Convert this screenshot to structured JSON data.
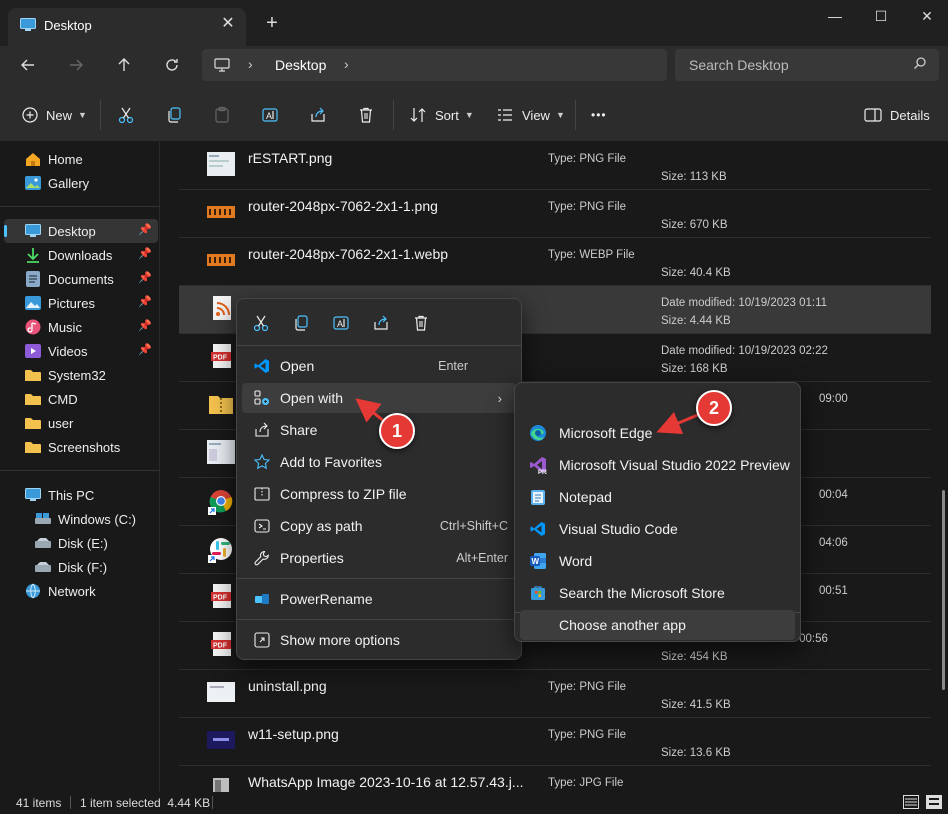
{
  "window": {
    "tab_title": "Desktop",
    "new_tab": "+",
    "minimize": "—",
    "maximize": "☐",
    "close": "✕",
    "tab_close": "✕"
  },
  "address": {
    "crumb": "Desktop",
    "search_placeholder": "Search Desktop"
  },
  "toolbar": {
    "new_label": "New",
    "sort_label": "Sort",
    "view_label": "View",
    "more_label": "•••",
    "details_label": "Details"
  },
  "sidebar": {
    "items": [
      {
        "label": "Home",
        "icon": "home-icon"
      },
      {
        "label": "Gallery",
        "icon": "gallery-icon"
      },
      {
        "label": "Desktop",
        "icon": "desktop-icon",
        "pinned": true,
        "selected": true
      },
      {
        "label": "Downloads",
        "icon": "download-icon",
        "pinned": true
      },
      {
        "label": "Documents",
        "icon": "documents-icon",
        "pinned": true
      },
      {
        "label": "Pictures",
        "icon": "pictures-icon",
        "pinned": true
      },
      {
        "label": "Music",
        "icon": "music-icon",
        "pinned": true
      },
      {
        "label": "Videos",
        "icon": "videos-icon",
        "pinned": true
      },
      {
        "label": "System32",
        "icon": "folder-icon"
      },
      {
        "label": "CMD",
        "icon": "folder-icon"
      },
      {
        "label": "user",
        "icon": "folder-icon"
      },
      {
        "label": "Screenshots",
        "icon": "folder-icon"
      },
      {
        "label": "This PC",
        "icon": "pc-icon"
      },
      {
        "label": "Windows (C:)",
        "icon": "drive-icon"
      },
      {
        "label": "Disk (E:)",
        "icon": "drive-icon"
      },
      {
        "label": "Disk (F:)",
        "icon": "drive-icon"
      },
      {
        "label": "Network",
        "icon": "network-icon"
      }
    ]
  },
  "files": [
    {
      "name": "rESTART.png",
      "type": "Type: PNG File",
      "size": "Size: 113 KB"
    },
    {
      "name": "router-2048px-7062-2x1-1.png",
      "type": "Type: PNG File",
      "size": "Size: 670 KB"
    },
    {
      "name": "router-2048px-7062-2x1-1.webp",
      "type": "Type: WEBP File",
      "size": "Size: 40.4 KB"
    },
    {
      "name": "",
      "date": "Date modified: 10/19/2023 01:11",
      "size": "Size: 4.44 KB"
    },
    {
      "name": "",
      "date": "Date modified: 10/19/2023 02:22",
      "size": "Size: 168 KB"
    },
    {
      "name": "",
      "date": "09:00",
      "size": ""
    },
    {
      "name": "",
      "date": "",
      "size": ""
    },
    {
      "name": "",
      "date": "00:04",
      "size": ""
    },
    {
      "name": "",
      "date": "04:06",
      "size": ""
    },
    {
      "name": "",
      "date": "00:51",
      "size": ""
    },
    {
      "name": "",
      "date": "Date modified: 10/19/2023 00:56",
      "size": "Size: 454 KB"
    },
    {
      "name": "uninstall.png",
      "type": "Type: PNG File",
      "size": "Size: 41.5 KB"
    },
    {
      "name": "w11-setup.png",
      "type": "Type: PNG File",
      "size": "Size: 13.6 KB"
    },
    {
      "name": "WhatsApp Image 2023-10-16 at 12.57.43.j...",
      "type": "Type: JPG File",
      "size": ""
    }
  ],
  "context_menu": {
    "items": [
      {
        "label": "Open",
        "shortcut": "Enter",
        "icon": "vscode-icon"
      },
      {
        "label": "Open with",
        "shortcut": "›",
        "icon": "open-with-icon"
      },
      {
        "label": "Share",
        "shortcut": "",
        "icon": "share-icon"
      },
      {
        "label": "Add to Favorites",
        "shortcut": "",
        "icon": "star-icon"
      },
      {
        "label": "Compress to ZIP file",
        "shortcut": "",
        "icon": "zip-icon"
      },
      {
        "label": "Copy as path",
        "shortcut": "Ctrl+Shift+C",
        "icon": "copy-path-icon"
      },
      {
        "label": "Properties",
        "shortcut": "Alt+Enter",
        "icon": "wrench-icon"
      },
      {
        "label": "PowerRename",
        "shortcut": "",
        "icon": "powerrename-icon"
      },
      {
        "label": "Show more options",
        "shortcut": "",
        "icon": "more-options-icon"
      }
    ]
  },
  "open_with": {
    "items": [
      {
        "label": "Microsoft Edge",
        "icon": "edge-icon"
      },
      {
        "label": "Microsoft Visual Studio 2022 Preview",
        "icon": "visual-studio-icon"
      },
      {
        "label": "Notepad",
        "icon": "notepad-icon"
      },
      {
        "label": "Visual Studio Code",
        "icon": "vscode-icon"
      },
      {
        "label": "Word",
        "icon": "word-icon"
      },
      {
        "label": "Search the Microsoft Store",
        "icon": "store-icon"
      },
      {
        "label": "Choose another app",
        "icon": ""
      }
    ]
  },
  "annotations": {
    "step1": "1",
    "step2": "2"
  },
  "status": {
    "items": "41 items",
    "selected": "1 item selected  4.44 KB"
  },
  "colors": {
    "accent": "#4cc2ff",
    "badge": "#e53935",
    "background": "#191919",
    "menu": "#2c2c2c"
  }
}
